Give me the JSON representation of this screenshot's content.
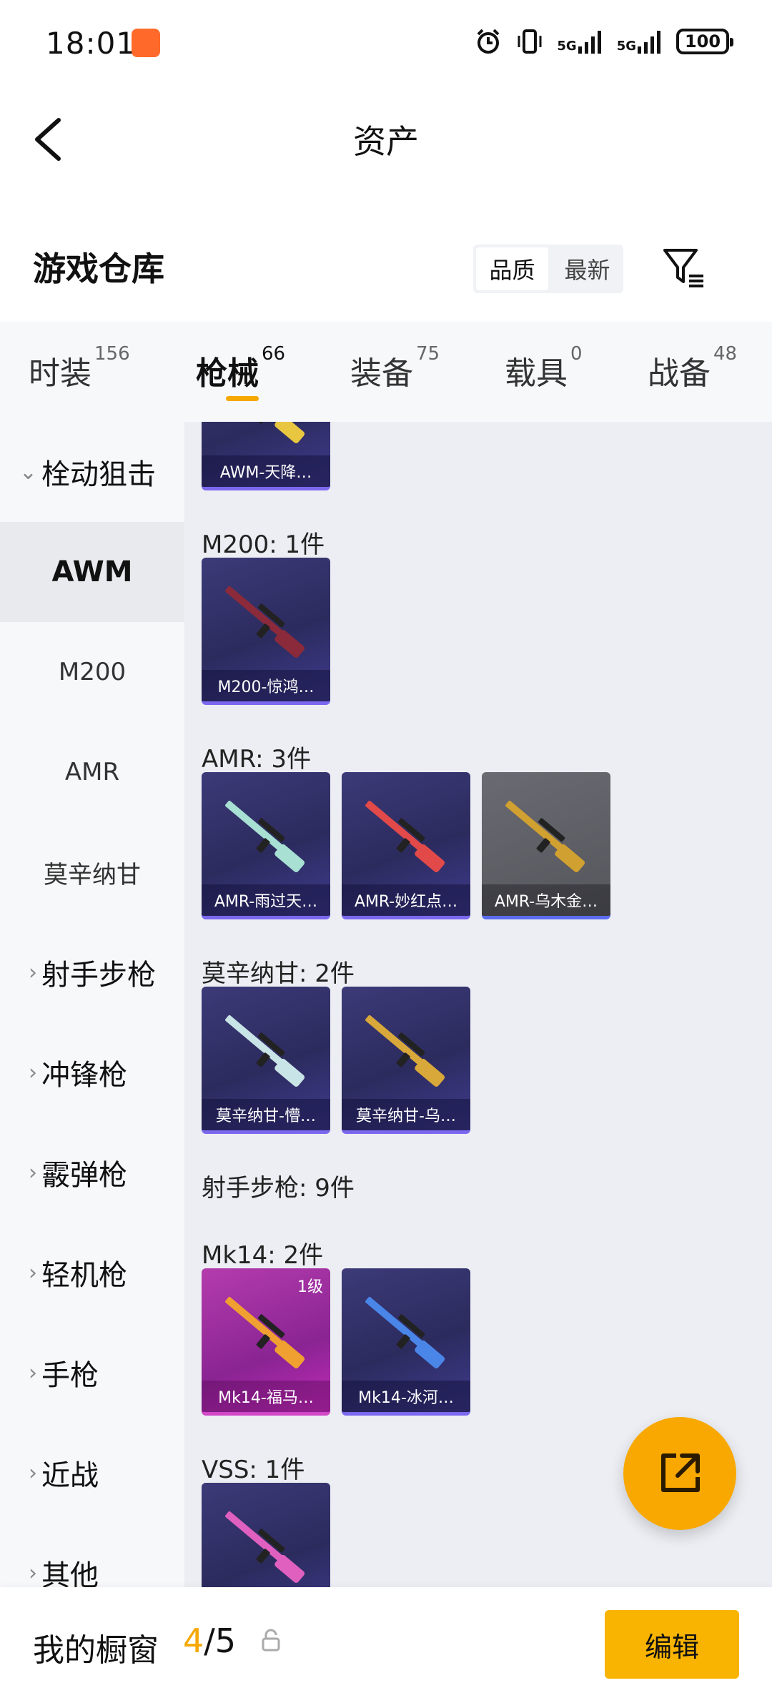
{
  "status_bar": {
    "time": "18:01",
    "network_1": "5G",
    "network_2": "5G",
    "battery": "100"
  },
  "header": {
    "title": "资产"
  },
  "section": {
    "title": "游戏仓库",
    "sort_options": [
      "品质",
      "最新"
    ],
    "active_sort": "品质"
  },
  "tabs": [
    {
      "label": "时装",
      "count": "156"
    },
    {
      "label": "枪械",
      "count": "66"
    },
    {
      "label": "装备",
      "count": "75"
    },
    {
      "label": "载具",
      "count": "0"
    },
    {
      "label": "战备",
      "count": "48"
    }
  ],
  "active_tab": "枪械",
  "sidebar": {
    "items": [
      {
        "label": "栓动狙击",
        "expanded": true
      },
      {
        "label": "AWM",
        "sub": true,
        "active": true
      },
      {
        "label": "M200",
        "sub": true
      },
      {
        "label": "AMR",
        "sub": true
      },
      {
        "label": "莫辛纳甘",
        "sub": true
      },
      {
        "label": "射手步枪"
      },
      {
        "label": "冲锋枪"
      },
      {
        "label": "霰弹枪"
      },
      {
        "label": "轻机枪"
      },
      {
        "label": "手枪"
      },
      {
        "label": "近战"
      },
      {
        "label": "其他"
      }
    ]
  },
  "content": {
    "groups": [
      {
        "label": "",
        "cards": [
          {
            "name": "AWM-天降…",
            "style": "purple",
            "gun_color": "#e8c640"
          }
        ]
      },
      {
        "label": "M200: 1件",
        "cards": [
          {
            "name": "M200-惊鸿…",
            "style": "purple",
            "gun_color": "#8a2a3a"
          }
        ]
      },
      {
        "label": "AMR: 3件",
        "cards": [
          {
            "name": "AMR-雨过天…",
            "style": "purple",
            "gun_color": "#a8e0d4"
          },
          {
            "name": "AMR-妙红点…",
            "style": "purple",
            "gun_color": "#e24a4a"
          },
          {
            "name": "AMR-乌木金…",
            "style": "grey",
            "gun_color": "#d0a030"
          }
        ]
      },
      {
        "label": "莫辛纳甘: 2件",
        "cards": [
          {
            "name": "莫辛纳甘-懵…",
            "style": "purple",
            "gun_color": "#c9e4e6"
          },
          {
            "name": "莫辛纳甘-乌…",
            "style": "purple",
            "gun_color": "#d8a83a"
          }
        ]
      },
      {
        "label": "射手步枪: 9件",
        "cards": []
      },
      {
        "label": "Mk14: 2件",
        "cards": [
          {
            "name": "Mk14-福马…",
            "style": "pink",
            "gun_color": "#f0a030",
            "level": "1级"
          },
          {
            "name": "Mk14-冰河…",
            "style": "purple",
            "gun_color": "#4a86e8"
          }
        ]
      },
      {
        "label": "VSS: 1件",
        "cards": [
          {
            "name": "",
            "style": "purple",
            "gun_color": "#e060c0"
          }
        ]
      }
    ]
  },
  "bottom_bar": {
    "label": "我的橱窗",
    "current": "4",
    "separator": "/",
    "total": "5",
    "edit_label": "编辑"
  },
  "colors": {
    "accent": "#f5a800",
    "fab": "#f8a800"
  }
}
